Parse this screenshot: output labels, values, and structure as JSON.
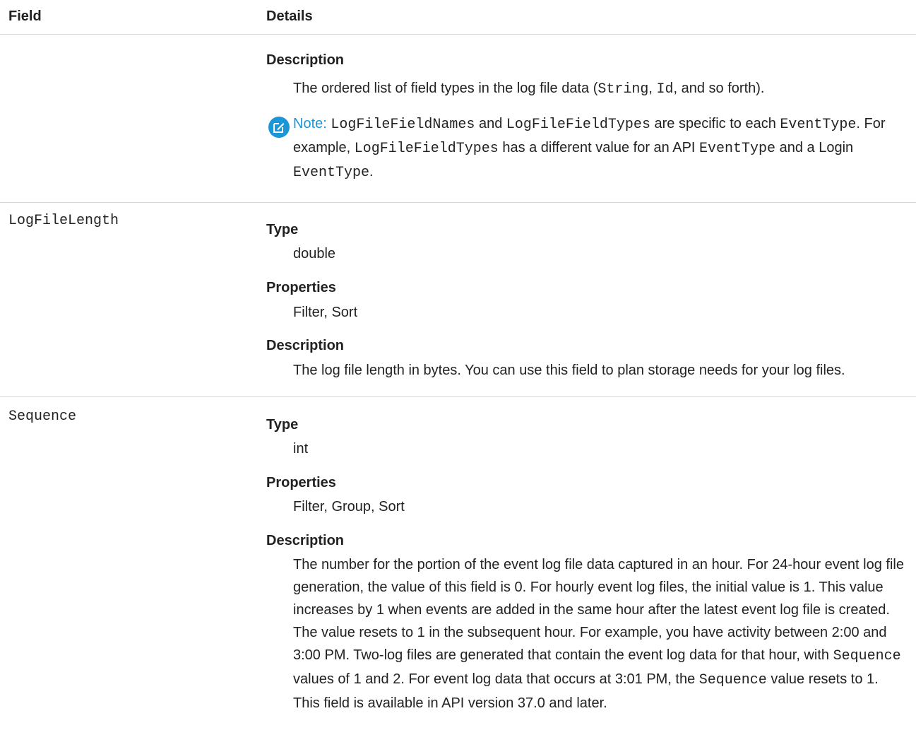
{
  "header": {
    "field": "Field",
    "details": "Details"
  },
  "top_row": {
    "description_label": "Description",
    "description": {
      "before": "The ordered list of field types in the log file data (",
      "code1": "String",
      "mid": ", ",
      "code2": "Id",
      "after": ", and so forth)."
    },
    "note": {
      "label": "Note:",
      "c1": "LogFileFieldNames",
      "t1": " and ",
      "c2": "LogFileFieldTypes",
      "t2": " are specific to each ",
      "c3": "EventType",
      "t3": ". For example, ",
      "c4": "LogFileFieldTypes",
      "t4": " has a different value for an API ",
      "c5": "EventType",
      "t5": " and a Login ",
      "c6": "EventType",
      "t6": "."
    }
  },
  "logfilelength": {
    "name": "LogFileLength",
    "type_label": "Type",
    "type": "double",
    "properties_label": "Properties",
    "properties": "Filter, Sort",
    "description_label": "Description",
    "description": "The log file length in bytes. You can use this field to plan storage needs for your log files."
  },
  "sequence": {
    "name": "Sequence",
    "type_label": "Type",
    "type": "int",
    "properties_label": "Properties",
    "properties": "Filter, Group, Sort",
    "description_label": "Description",
    "desc": {
      "p1": "The number for the portion of the event log file data captured in an hour. For 24-hour event log file generation, the value of this field is 0. For hourly event log files, the initial value is 1. This value increases by 1 when events are added in the same hour after the latest event log file is created. The value resets to 1 in the subsequent hour. For example, you have activity between 2:00 and 3:00 PM. Two-log files are generated that contain the event log data for that hour, with ",
      "c1": "Sequence",
      "p2": " values of 1 and 2. For event log data that occurs at 3:01 PM, the ",
      "c2": "Sequence",
      "p3": " value resets to 1. This field is available in API version 37.0 and later."
    }
  }
}
